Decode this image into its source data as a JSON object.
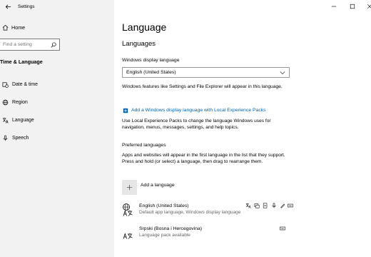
{
  "window": {
    "app_title": "Settings"
  },
  "sidebar": {
    "home_label": "Home",
    "search_placeholder": "Find a setting",
    "section_title": "Time & Language",
    "items": [
      {
        "label": "Date & time",
        "icon": "calendar-clock-icon"
      },
      {
        "label": "Region",
        "icon": "globe-icon"
      },
      {
        "label": "Language",
        "icon": "language-icon"
      },
      {
        "label": "Speech",
        "icon": "microphone-icon"
      }
    ]
  },
  "main": {
    "title": "Language",
    "languages_heading": "Languages",
    "display_language_label": "Windows display language",
    "display_language_value": "English (United States)",
    "display_language_desc": "Windows features like Settings and File Explorer will appear in this language.",
    "add_display_link": "Add a Windows display language with Local Experience Packs",
    "link_desc": "Use Local Experience Packs to change the language Windows uses for navigation, menus, messages, settings, and help topics.",
    "preferred_heading": "Preferred languages",
    "preferred_desc": "Apps and websites will appear in the first language in the list that they support. Press and hold (or select) a language, then drag to rearrange them.",
    "add_language_label": "Add a language",
    "languages": [
      {
        "name": "English (United States)",
        "status": "Default app language, Windows display language"
      },
      {
        "name": "Srpski (Bosna i Hercegovina)",
        "status": "Language pack available"
      }
    ]
  },
  "colors": {
    "sidebar_bg": "#f2f2f2",
    "link": "#0063b1",
    "accent_add_box": "#e6e6e6"
  }
}
